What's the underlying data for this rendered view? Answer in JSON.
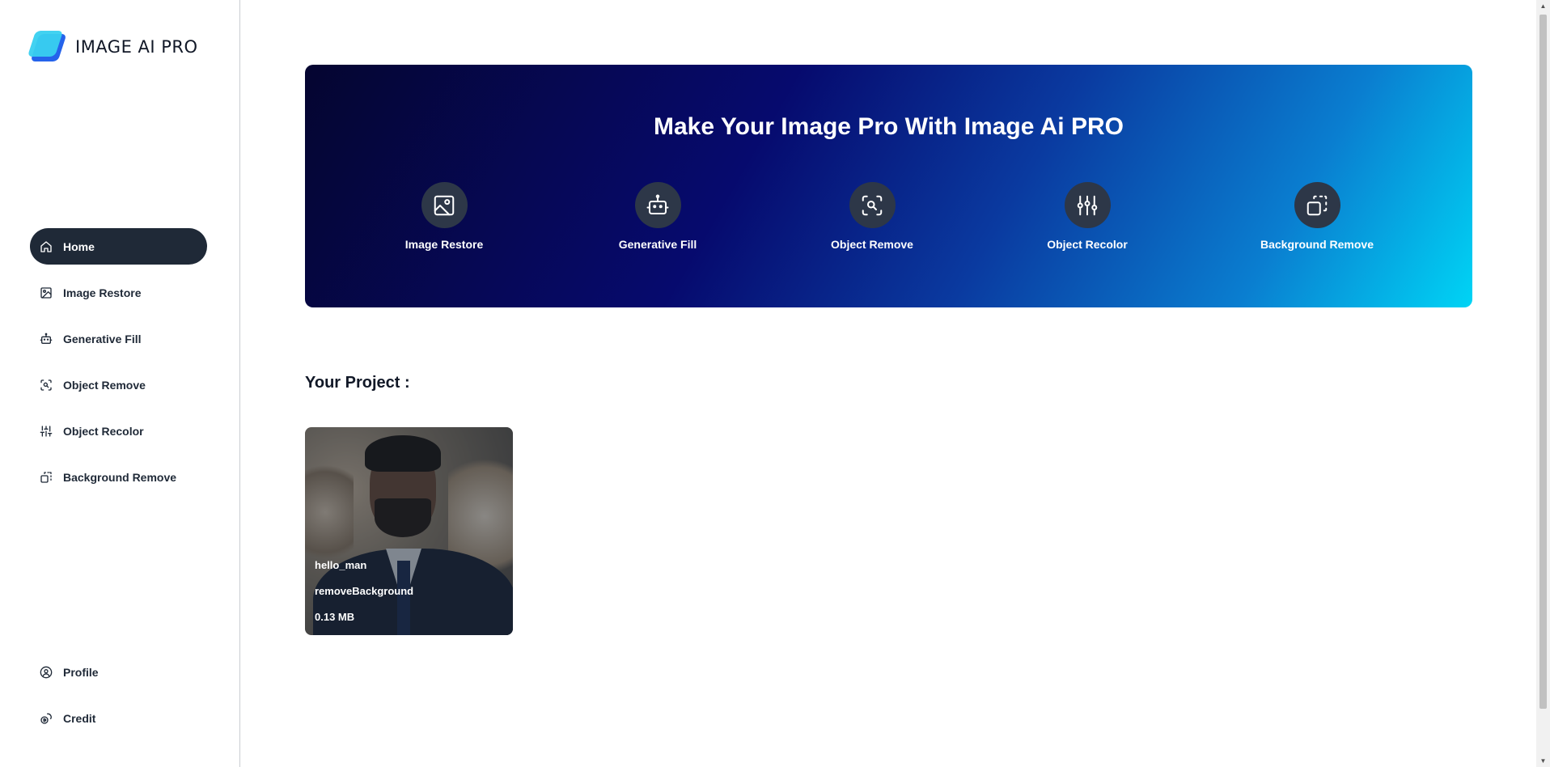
{
  "app": {
    "logo_text": "IMAGE AI PRO",
    "accent": "#1f2937",
    "brand_cyan": "#38d0f0",
    "brand_blue": "#2563eb"
  },
  "sidebar": {
    "items": [
      {
        "label": "Home",
        "icon": "home-icon",
        "active": true
      },
      {
        "label": "Image Restore",
        "icon": "image-icon"
      },
      {
        "label": "Generative Fill",
        "icon": "robot-icon"
      },
      {
        "label": "Object Remove",
        "icon": "scan-search-icon"
      },
      {
        "label": "Object Recolor",
        "icon": "sliders-icon"
      },
      {
        "label": "Background Remove",
        "icon": "layers-dashed-icon"
      }
    ],
    "bottom_items": [
      {
        "label": "Profile",
        "icon": "user-circle-icon"
      },
      {
        "label": "Credit",
        "icon": "coins-icon"
      }
    ]
  },
  "hero": {
    "title": "Make Your Image Pro With Image Ai PRO",
    "tools": [
      {
        "label": "Image Restore",
        "icon": "image-icon"
      },
      {
        "label": "Generative Fill",
        "icon": "robot-icon"
      },
      {
        "label": "Object Remove",
        "icon": "scan-search-icon"
      },
      {
        "label": "Object Recolor",
        "icon": "sliders-icon"
      },
      {
        "label": "Background Remove",
        "icon": "layers-dashed-icon"
      }
    ]
  },
  "projects": {
    "title": "Your Project :",
    "items": [
      {
        "name": "hello_man",
        "type": "removeBackground",
        "size": "0.13 MB"
      }
    ]
  }
}
